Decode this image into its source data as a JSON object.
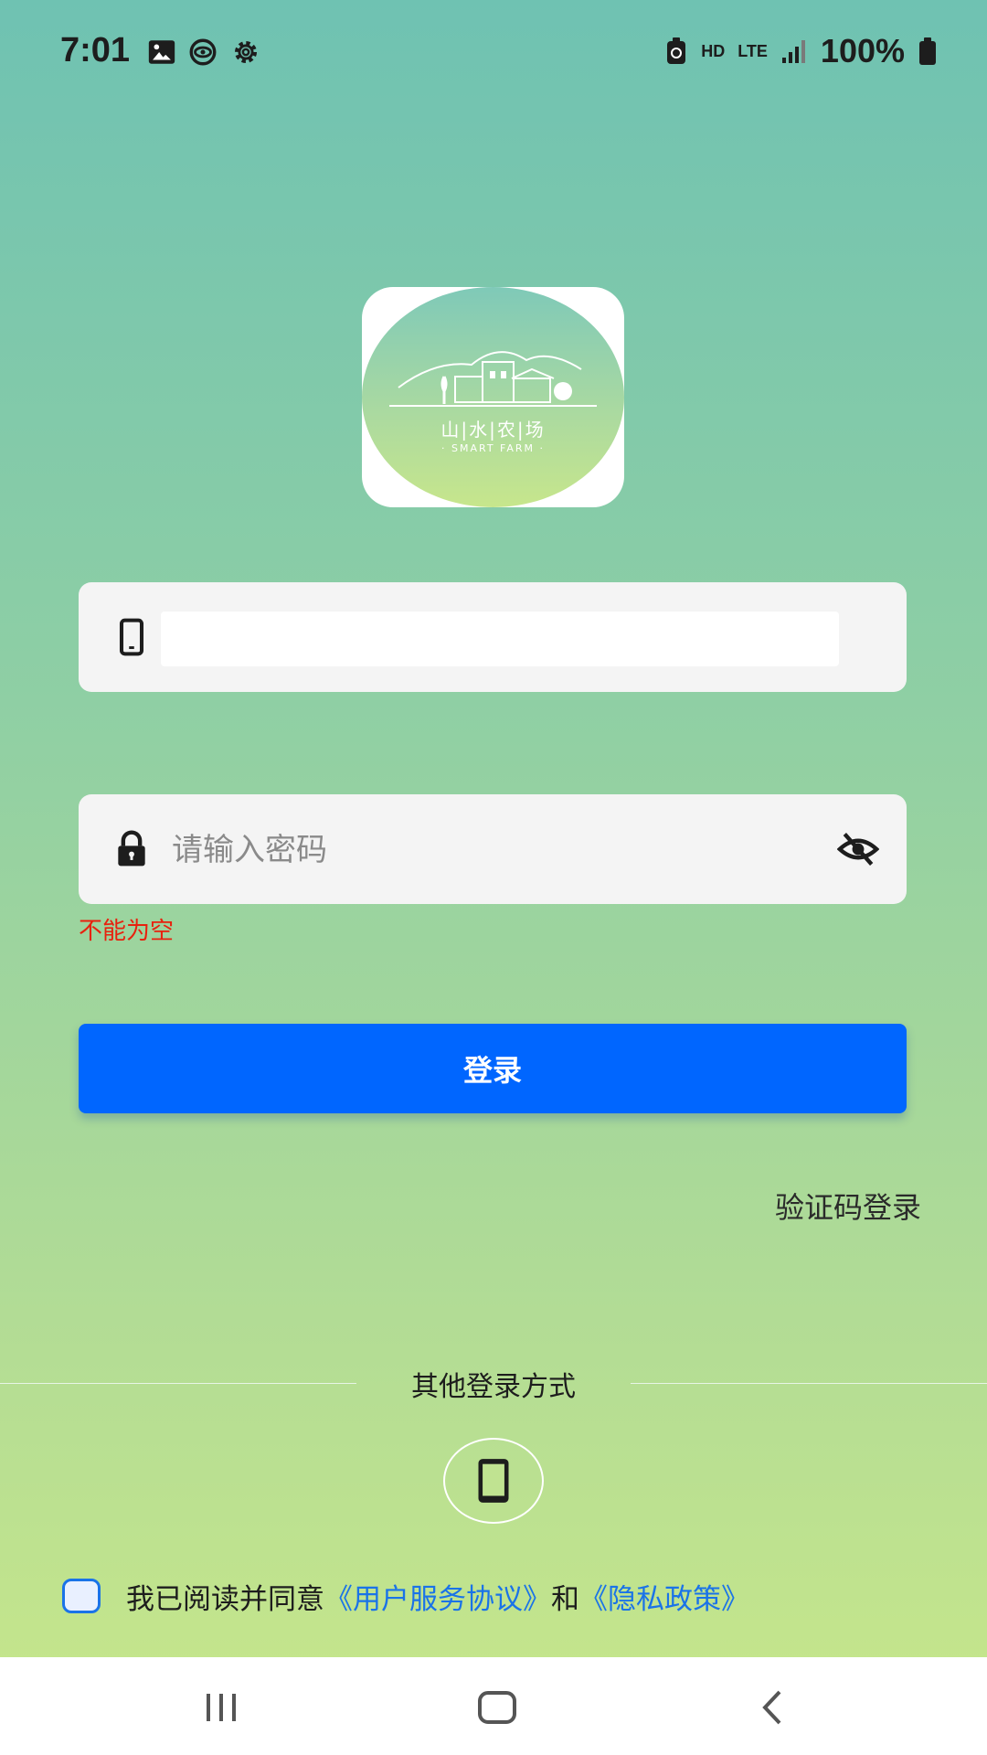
{
  "status_bar": {
    "time": "7:01",
    "network_hd": "HD",
    "network_type": "LTE",
    "battery": "100%",
    "icons": [
      "image-icon",
      "eye-sync-icon",
      "gear-icon",
      "battery-saver-icon",
      "signal-icon",
      "battery-icon"
    ]
  },
  "logo": {
    "title": "山|水|农|场",
    "subtitle": "· SMART FARM ·"
  },
  "phone_field": {
    "icon": "phone-icon",
    "value": ""
  },
  "password_field": {
    "icon": "lock-icon",
    "placeholder": "请输入密码",
    "value": "",
    "toggle_icon": "eye-off-icon"
  },
  "error_text": "不能为空",
  "login_button": "登录",
  "sms_login_link": "验证码登录",
  "other_login": {
    "label": "其他登录方式",
    "icon": "phone-icon"
  },
  "agreement": {
    "checked": false,
    "prefix": "我已阅读并同意",
    "terms_link": "《用户服务协议》",
    "and": "和",
    "privacy_link": "《隐私政策》"
  },
  "nav_bar": {
    "icons": [
      "recent-apps-icon",
      "home-icon",
      "back-icon"
    ]
  },
  "colors": {
    "accent": "#0066ff",
    "link": "#1a73e8",
    "error": "#e8210e",
    "bg_top": "#6fc2b2",
    "bg_bottom": "#c4e58c"
  }
}
